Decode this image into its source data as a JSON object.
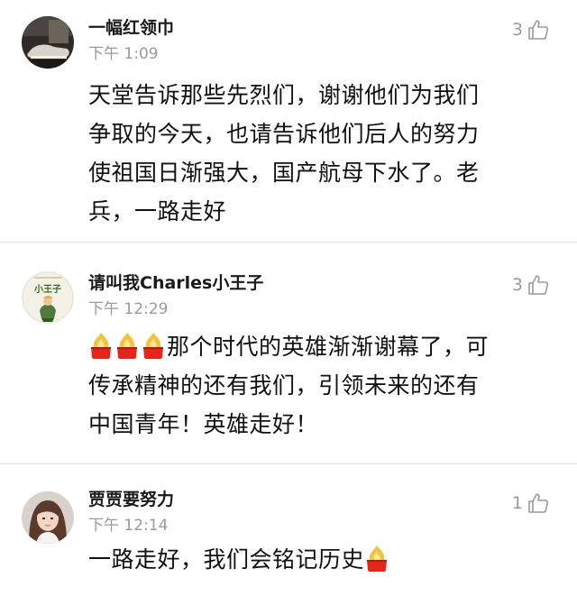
{
  "comments": [
    {
      "username": "一幅红领巾",
      "time": "下午 1:09",
      "likes": "3",
      "avatar_icon": "sneaker-photo-avatar",
      "lines": [
        "天堂告诉那些先烈们，谢谢他们为我们",
        "争取的今天，也请告诉他们后人的努力",
        "使祖国日渐强大，国产航母下水了。老",
        "兵，一路走好"
      ]
    },
    {
      "username": "请叫我Charles小王子",
      "time": "下午 12:29",
      "likes": "3",
      "avatar_icon": "little-prince-avatar",
      "avatar_text": "小王子",
      "line1_emoji": "candle-flame-icon",
      "lines": [
        "那个时代的英雄渐渐谢幕了，可",
        "传承精神的还有我们，引领未来的还有",
        "中国青年！英雄走好！"
      ]
    },
    {
      "username": "贾贾要努力",
      "time": "下午 12:14",
      "likes": "1",
      "avatar_icon": "girl-photo-avatar",
      "line_emoji": "candle-flame-icon",
      "lines": [
        "一路走好，我们会铭记历史"
      ]
    }
  ],
  "colors": {
    "name": "#1a1a1a",
    "meta": "#9a9a9a",
    "divider": "#e2e2e2",
    "flame_red": "#e8231a",
    "flame_yellow": "#f7c23b"
  }
}
